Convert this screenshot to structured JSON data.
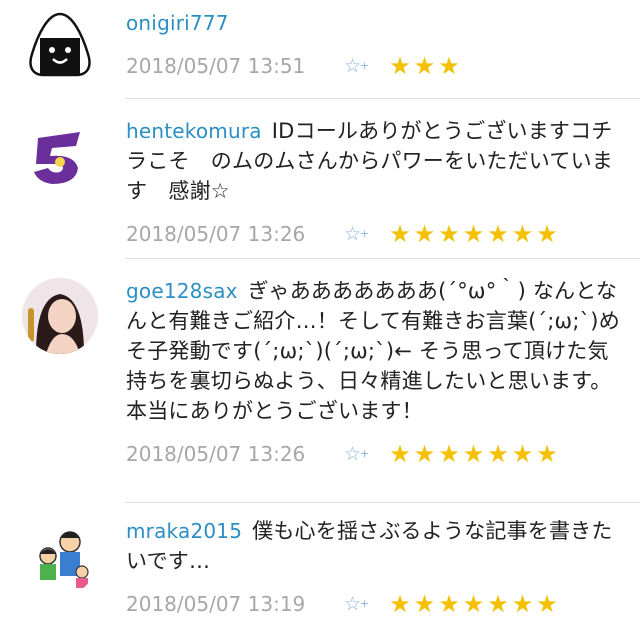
{
  "comments": [
    {
      "username": "onigiri777",
      "text": "",
      "timestamp": "2018/05/07 13:51",
      "star_count": 3,
      "avatar": "onigiri-avatar"
    },
    {
      "username": "hentekomura",
      "text": "IDコールありがとうございますコチラこそ　のムのムさんからパワーをいただいています　感謝☆",
      "timestamp": "2018/05/07 13:26",
      "star_count": 7,
      "avatar": "purple-logo-avatar"
    },
    {
      "username": "goe128sax",
      "text": "ぎゃあああああああ(´°ω°｀) なんとなんと有難きご紹介…！そして有難きお言葉(´;ω;`)めそ子発動です(´;ω;`)(´;ω;`)← そう思って頂けた気持ちを裏切らぬよう、日々精進したいと思います。本当にありがとうございます！",
      "timestamp": "2018/05/07 13:26",
      "star_count": 7,
      "avatar": "photo-avatar"
    },
    {
      "username": "mraka2015",
      "text": "僕も心を揺さぶるような記事を書きたいです…",
      "timestamp": "2018/05/07 13:19",
      "star_count": 7,
      "avatar": "family-drawing-avatar"
    }
  ],
  "icons": {
    "add_star": "☆",
    "add_plus": "+",
    "star": "★"
  },
  "colors": {
    "username": "#2c8fc3",
    "star": "#f5c000",
    "timestamp": "#a7a7a7",
    "add_star": "#8ab4da"
  }
}
